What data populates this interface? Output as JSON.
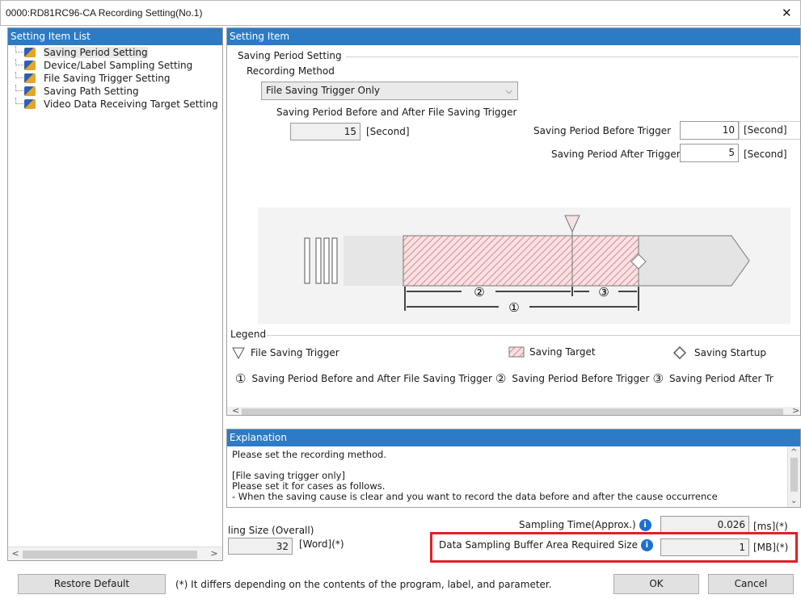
{
  "window": {
    "title": "0000:RD81RC96-CA Recording Setting(No.1)",
    "close": "✕"
  },
  "left_panel": {
    "header": "Setting Item List",
    "items": [
      {
        "label": "Saving Period Setting"
      },
      {
        "label": "Device/Label Sampling Setting"
      },
      {
        "label": "File Saving Trigger Setting"
      },
      {
        "label": "Saving Path Setting"
      },
      {
        "label": "Video Data Receiving Target Setting"
      }
    ]
  },
  "right_panel": {
    "header": "Setting Item",
    "group_title": "Saving Period Setting",
    "recording_method_label": "Recording Method",
    "recording_method_value": "File Saving Trigger Only",
    "period_before_after_label": "Saving Period Before and After File Saving Trigger",
    "period_before_after_value": "15",
    "unit_second": "[Second]",
    "before_trigger_label": "Saving Period Before Trigger",
    "before_trigger_value": "10",
    "before_trigger_unit": "[Second]",
    "after_trigger_label": "Saving Period After Trigger",
    "after_trigger_value": "5",
    "after_trigger_unit": "[Second]",
    "diagram": {
      "n1": "①",
      "n2": "②",
      "n3": "③"
    },
    "legend": {
      "title": "Legend",
      "file_saving_trigger": "File Saving Trigger",
      "saving_target": "Saving Target",
      "saving_startup": "Saving Startup",
      "n1": "①",
      "n1_text": "Saving Period Before and After File Saving Trigger",
      "n2": "②",
      "n2_text": "Saving Period Before Trigger",
      "n3": "③",
      "n3_text": "Saving Period After Tr"
    }
  },
  "explanation": {
    "header": "Explanation",
    "text": "Please set the recording method.\n\n[File saving trigger only]\nPlease set it for cases as follows.\n- When the saving cause is clear and you want to record the data before and after the cause occurrence"
  },
  "footer": {
    "sampling_size_label": "ling Size (Overall)",
    "sampling_size_value": "32",
    "sampling_size_unit": "[Word](*)",
    "sampling_time_label": "Sampling Time(Approx.)",
    "sampling_time_value": "0.026",
    "sampling_time_unit": "[ms](*)",
    "buffer_label": "Data Sampling Buffer Area Required Size",
    "buffer_value": "1",
    "buffer_unit": "[MB](*)",
    "restore_default": "Restore Default",
    "note": "(*) It differs depending on the contents of the program, label, and parameter.",
    "ok": "OK",
    "cancel": "Cancel"
  },
  "colors": {
    "header_blue": "#2d7bc4",
    "highlight_red": "#e0202a",
    "hatch": "#d98a8f"
  }
}
